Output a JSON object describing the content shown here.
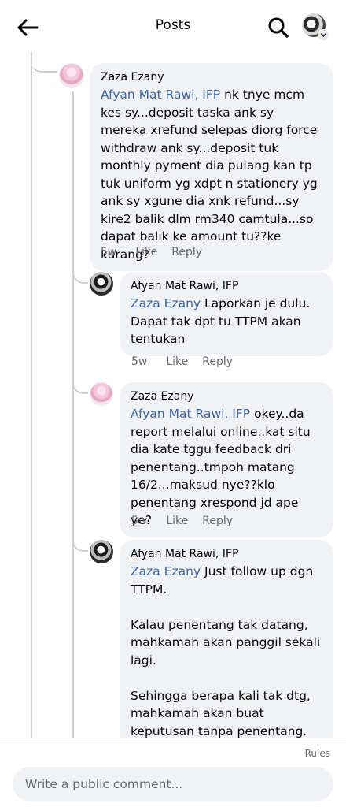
{
  "header": {
    "title": "Posts"
  },
  "comments": [
    {
      "author": "Zaza Ezany",
      "mention": "Afyan Mat Rawi, IFP",
      "text": " nk tnye mcm kes sy...deposit taska ank sy mereka xrefund selepas diorg force withdraw ank sy...deposit tuk monthly pyment dia pulang kan tp tuk uniform yg xdpt n stationery yg ank sy xgune dia xnk refund...sy kire2 balik dlm rm340 camtula...so dapat balik ke amount tu??ke kurang?",
      "time": "5w",
      "like": "Like",
      "reply": "Reply"
    },
    {
      "author": "Afyan Mat Rawi, IFP",
      "mention": "Zaza Ezany",
      "text": " Laporkan je dulu. Dapat tak dpt tu TTPM akan tentukan",
      "time": "5w",
      "like": "Like",
      "reply": "Reply"
    },
    {
      "author": "Zaza Ezany",
      "mention": "Afyan Mat Rawi, IFP",
      "text": " okey..da report melalui online..kat situ dia kate tggu feedback dri penentang..tmpoh matang 16/2...maksud nye??klo penentang xrespond jd ape ye?",
      "time": "5w",
      "like": "Like",
      "reply": "Reply"
    },
    {
      "author": "Afyan Mat Rawi, IFP",
      "mention": "Zaza Ezany",
      "text": " Just follow up dgn TTPM.\n\nKalau penentang tak datang, mahkamah akan panggil sekali lagi.\n\nSehingga berapa kali tak dtg, mahkamah akan buat keputusan tanpa penentang."
    }
  ],
  "footer": {
    "rules": "Rules",
    "comment_placeholder": "Write a public comment..."
  }
}
